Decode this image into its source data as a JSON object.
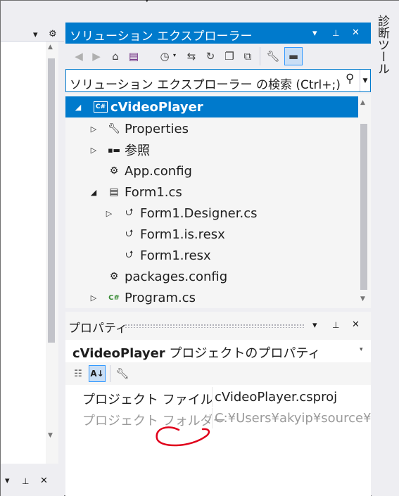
{
  "left_panel": {
    "top_buttons": [
      "▾",
      "⚙"
    ],
    "bottom_buttons": [
      "▾",
      "⊥",
      "✕"
    ]
  },
  "solution_explorer": {
    "title": "ソリューション エクスプローラー",
    "title_buttons": [
      "▾",
      "⊥",
      "✕"
    ],
    "toolbar_icons": [
      "back-icon",
      "forward-icon",
      "home-icon",
      "switch-views-icon",
      "pending-changes-filter-icon",
      "sync-icon",
      "refresh-icon",
      "collapse-all-icon",
      "show-all-files-icon",
      "properties-icon",
      "preview-icon"
    ],
    "search": {
      "placeholder": "ソリューション エクスプローラー の検索 (Ctrl+;)"
    },
    "tree": [
      {
        "label": "cVideoPlayer",
        "icon": "csharp-project-icon",
        "expander": "◢",
        "selected": true
      },
      {
        "label": "Properties",
        "icon": "wrench-icon",
        "expander": "▷"
      },
      {
        "label": "参照",
        "icon": "references-icon",
        "expander": "▷"
      },
      {
        "label": "App.config",
        "icon": "config-file-icon",
        "expander": ""
      },
      {
        "label": "Form1.cs",
        "icon": "form-icon",
        "expander": "◢"
      },
      {
        "label": "Form1.Designer.cs",
        "icon": "csharp-file-icon",
        "expander": "▷"
      },
      {
        "label": "Form1.is.resx",
        "icon": "resx-file-icon",
        "expander": ""
      },
      {
        "label": "Form1.resx",
        "icon": "resx-file-icon",
        "expander": ""
      },
      {
        "label": "packages.config",
        "icon": "config-file-icon",
        "expander": ""
      },
      {
        "label": "Program.cs",
        "icon": "csharp-file-icon",
        "expander": "▷"
      }
    ]
  },
  "properties": {
    "title": "プロパティ",
    "title_buttons": [
      "▾",
      "⊥",
      "✕"
    ],
    "object_name": "cVideoPlayer",
    "object_type": "プロジェクトのプロパティ",
    "rows": [
      {
        "name": "プロジェクト ファイル",
        "value": "cVideoPlayer.csproj"
      },
      {
        "name": "プロジェクト フォルダー",
        "value": "C:¥Users¥akyip¥source¥re"
      }
    ]
  },
  "right_tab": {
    "label": "診断ツール"
  },
  "colors": {
    "accent": "#007acc",
    "annotation": "#e0001b"
  }
}
